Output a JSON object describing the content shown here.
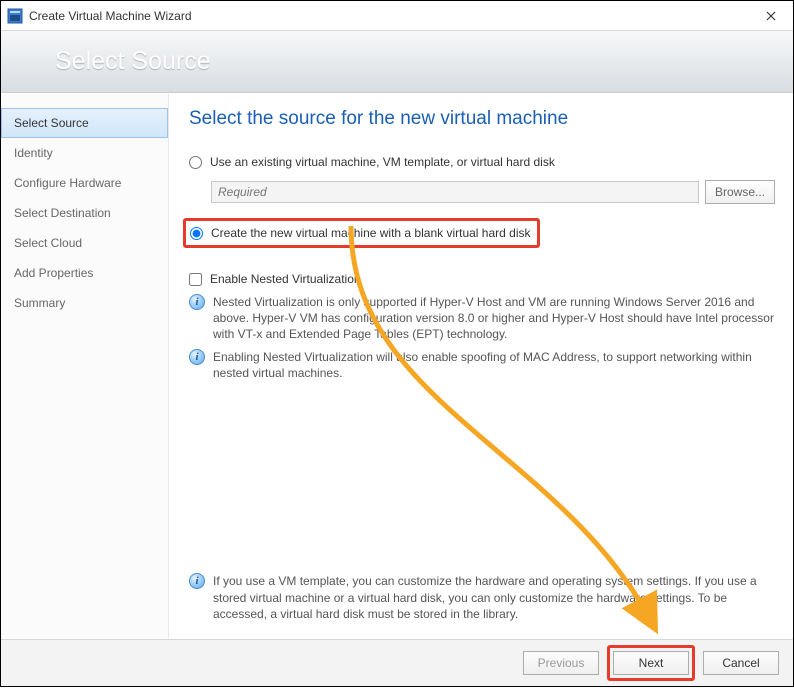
{
  "window": {
    "title": "Create Virtual Machine Wizard"
  },
  "banner": {
    "title": "Select Source"
  },
  "sidebar": {
    "items": [
      {
        "label": "Select Source",
        "active": true
      },
      {
        "label": "Identity",
        "active": false
      },
      {
        "label": "Configure Hardware",
        "active": false
      },
      {
        "label": "Select Destination",
        "active": false
      },
      {
        "label": "Select Cloud",
        "active": false
      },
      {
        "label": "Add Properties",
        "active": false
      },
      {
        "label": "Summary",
        "active": false
      }
    ]
  },
  "main": {
    "heading": "Select the source for the new virtual machine",
    "radio_existing": {
      "label": "Use an existing virtual machine, VM template, or virtual hard disk",
      "checked": false
    },
    "path_placeholder": "Required",
    "browse_label": "Browse...",
    "radio_blank": {
      "label": "Create the new virtual machine with a blank virtual hard disk",
      "checked": true
    },
    "nested_check": {
      "label": "Enable Nested Virtualization",
      "checked": false
    },
    "info1": "Nested Virtualization is only supported if Hyper-V Host and VM are running Windows Server 2016 and above. Hyper-V VM has configuration version 8.0 or higher and Hyper-V Host should have Intel processor with VT-x and Extended Page Tables (EPT) technology.",
    "info2": "Enabling Nested Virtualization will also enable spoofing of MAC Address, to support networking within nested virtual machines.",
    "footer_info": "If you use a VM template, you can customize the hardware and operating system settings. If you use a stored virtual machine or a virtual hard disk, you can only customize the hardware settings. To be accessed, a virtual hard disk must be stored in the library."
  },
  "buttons": {
    "previous": "Previous",
    "next": "Next",
    "cancel": "Cancel"
  }
}
